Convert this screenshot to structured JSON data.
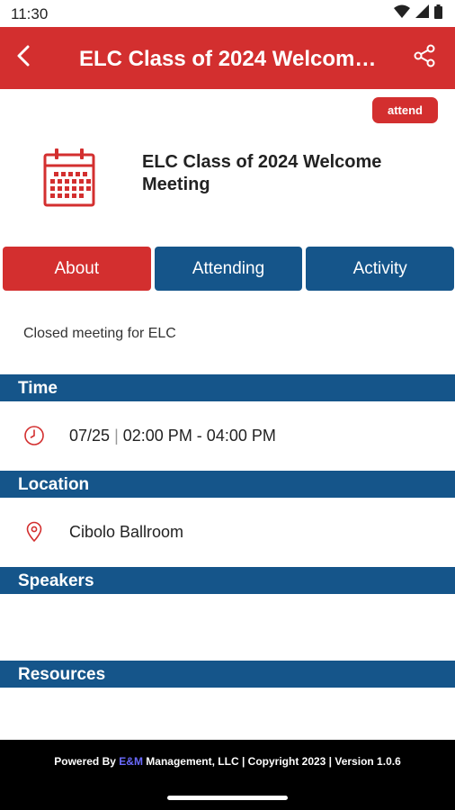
{
  "status_bar": {
    "time": "11:30"
  },
  "app_bar": {
    "title": "ELC Class of 2024 Welcome Meeting"
  },
  "attend_label": "attend",
  "event": {
    "title": "ELC Class of 2024 Welcome Meeting"
  },
  "tabs": [
    {
      "label": "About"
    },
    {
      "label": "Attending"
    },
    {
      "label": "Activity"
    }
  ],
  "description": "Closed meeting for ELC",
  "sections": {
    "time": "Time",
    "location": "Location",
    "speakers": "Speakers",
    "resources": "Resources"
  },
  "time": {
    "date": "07/25",
    "separator": "|",
    "range": "02:00 PM - 04:00 PM"
  },
  "location": {
    "name": "Cibolo Ballroom"
  },
  "footer": {
    "prefix": "Powered By ",
    "brand": "E&M",
    "suffix": " Management, LLC | Copyright 2023 | Version 1.0.6"
  },
  "colors": {
    "primary_red": "#d32f2f",
    "primary_blue": "#15558a",
    "footer_bg": "#000000"
  }
}
